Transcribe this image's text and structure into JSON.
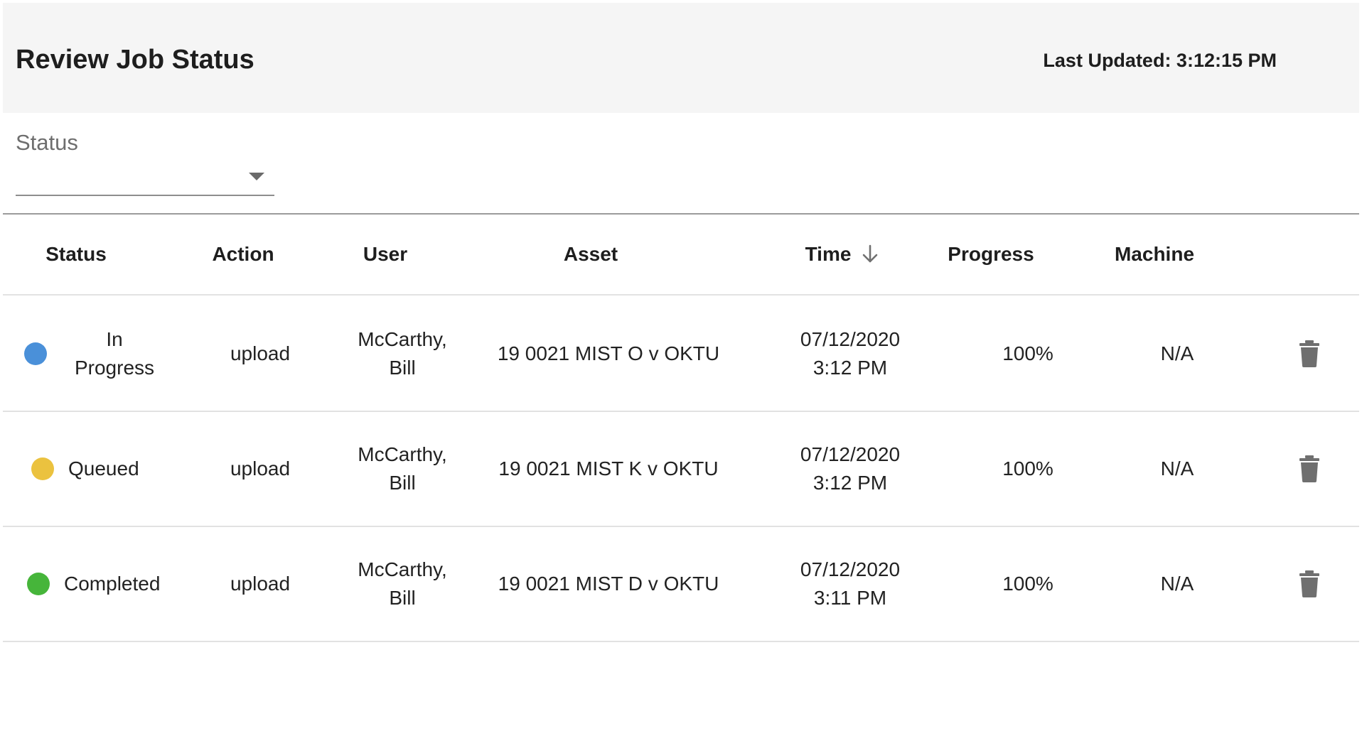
{
  "header": {
    "title": "Review Job Status",
    "last_updated": "Last Updated: 3:12:15 PM"
  },
  "filter": {
    "label": "Status",
    "value": ""
  },
  "table": {
    "columns": [
      "Status",
      "Action",
      "User",
      "Asset",
      "Time",
      "Progress",
      "Machine"
    ],
    "sort_column": "Time",
    "sort_direction": "descending",
    "rows": [
      {
        "status": "In Progress",
        "status_color": "#4a90d9",
        "action": "upload",
        "user": "McCarthy, Bill",
        "asset": "19 0021 MIST O v OKTU",
        "time": "07/12/2020 3:12 PM",
        "progress": "100%",
        "machine": "N/A"
      },
      {
        "status": "Queued",
        "status_color": "#ebc23f",
        "action": "upload",
        "user": "McCarthy, Bill",
        "asset": "19 0021 MIST K v OKTU",
        "time": "07/12/2020 3:12 PM",
        "progress": "100%",
        "machine": "N/A"
      },
      {
        "status": "Completed",
        "status_color": "#46b53a",
        "action": "upload",
        "user": "McCarthy, Bill",
        "asset": "19 0021 MIST D v OKTU",
        "time": "07/12/2020 3:11 PM",
        "progress": "100%",
        "machine": "N/A"
      }
    ],
    "row_action_icon": "trash-icon"
  }
}
